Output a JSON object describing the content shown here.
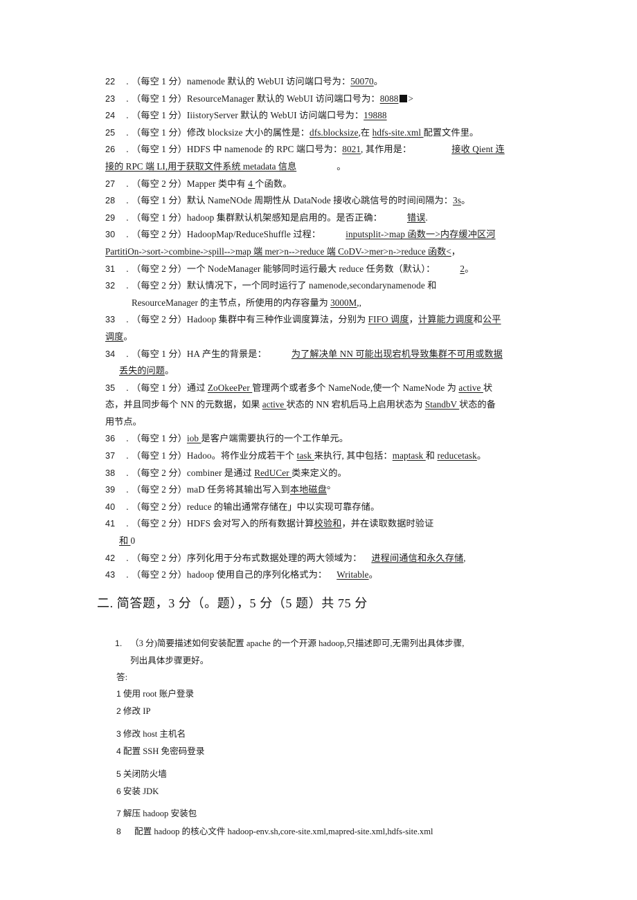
{
  "document": {
    "fill_in_blanks": [
      {
        "number": "22",
        "separator": ".",
        "parts": [
          {
            "t": "（每空 1 分）namenode 默认的 WebUI 访问端口号为：",
            "u": false
          },
          {
            "t": "50070",
            "u": true
          },
          {
            "t": "。",
            "u": false
          }
        ]
      },
      {
        "number": "23",
        "separator": ".",
        "parts": [
          {
            "t": "（每空 1 分）ResourceManager 默认的 WebUI 访问端口号为：",
            "u": false
          },
          {
            "t": "8088",
            "u": true
          },
          {
            "t": "BLACKBOX",
            "u": false
          },
          {
            "t": ">",
            "u": false
          }
        ]
      },
      {
        "number": "24",
        "separator": ".",
        "parts": [
          {
            "t": "（每空 1 分）IiistoryServer 默认的 WebUI 访问端口号为：",
            "u": false
          },
          {
            "t": "19888",
            "u": true
          }
        ]
      },
      {
        "number": "25",
        "separator": ".",
        "parts": [
          {
            "t": "（每空 1 分）修改 blocksize 大小的属性是：",
            "u": false
          },
          {
            "t": "dfs.blocksize",
            "u": true
          },
          {
            "t": ",在 ",
            "u": false
          },
          {
            "t": "hdfs-site.xml ",
            "u": true
          },
          {
            "t": "配置文件里。",
            "u": false
          }
        ]
      },
      {
        "number": "26",
        "separator": ".",
        "parts": [
          {
            "t": "（每空 1 分）HDFS 中 namenode 的 RPC 端口号为：",
            "u": false
          },
          {
            "t": "8021",
            "u": true
          },
          {
            "t": ", 其作用是：",
            "u": false
          },
          {
            "t": "GAP_LG",
            "u": false
          },
          {
            "t": "接收 Qient 连",
            "u": true
          }
        ],
        "continuation": [
          {
            "indent": "none",
            "parts": [
              {
                "t": "接的 RPC 端 LI,用于获取文件系统 metadata 信息",
                "u": true
              },
              {
                "t": "GAP_LG",
                "u": false
              },
              {
                "t": "。",
                "u": false
              }
            ]
          }
        ]
      },
      {
        "number": "27",
        "separator": ".",
        "parts": [
          {
            "t": "（每空 2 分）Mapper 类中有 ",
            "u": false
          },
          {
            "t": "4 ",
            "u": true
          },
          {
            "t": "个函数。",
            "u": false
          }
        ]
      },
      {
        "number": "28",
        "separator": ".",
        "parts": [
          {
            "t": "（每空 1 分）默认 NameNOde 周期性从 DataNode 接收心跳信号的时间间隔为：",
            "u": false
          },
          {
            "t": "3s",
            "u": true
          },
          {
            "t": "。",
            "u": false
          }
        ]
      },
      {
        "number": "29",
        "separator": ".",
        "parts": [
          {
            "t": "（每空 1 分）hadoop 集群默认机架感知是启用的。是否正确：",
            "u": false
          },
          {
            "t": "GAP",
            "u": false
          },
          {
            "t": "错误",
            "u": true
          },
          {
            "t": ".",
            "u": false
          }
        ]
      },
      {
        "number": "30",
        "separator": ".",
        "parts": [
          {
            "t": "（每空 2 分）HadoopMap/ReduceShuffle 过程：",
            "u": false
          },
          {
            "t": "GAP",
            "u": false
          },
          {
            "t": "inputsplit->map 函数一>内存缓冲区河",
            "u": true
          }
        ],
        "continuation": [
          {
            "indent": "none",
            "parts": [
              {
                "t": "PartitiOn->sort->combine->spill-->map 端 mer>n-->reduce 端 CoDV->mer>n->reduce 函数<",
                "u": true
              },
              {
                "t": "，",
                "u": false
              }
            ]
          }
        ]
      },
      {
        "number": "31",
        "separator": ".",
        "parts": [
          {
            "t": "（每空 2 分）一个 NodeManager 能够同时运行最大 reduce 任务数（默认）：",
            "u": false
          },
          {
            "t": "GAP",
            "u": false
          },
          {
            "t": "2",
            "u": true
          },
          {
            "t": "。",
            "u": false
          }
        ]
      },
      {
        "number": "32",
        "separator": ".",
        "parts": [
          {
            "t": "（每空 2 分）默认情况下，一个同时运行了 namenode,secondarynamenode 和",
            "u": false
          }
        ],
        "continuation": [
          {
            "indent": "ind",
            "parts": [
              {
                "t": "ResourceManager 的主节点，所使用的内存容量为 ",
                "u": false
              },
              {
                "t": "3000M",
                "u": true
              },
              {
                "t": ",,",
                "u": false
              }
            ]
          }
        ]
      },
      {
        "number": "33",
        "separator": ".",
        "parts": [
          {
            "t": "（每空 2 分）Hadoop 集群中有三种作业调度算法，分别为 ",
            "u": false
          },
          {
            "t": "FIFO 调度",
            "u": true
          },
          {
            "t": "，",
            "u": false
          },
          {
            "t": "计算能力调度",
            "u": true
          },
          {
            "t": "和",
            "u": false
          },
          {
            "t": "公平",
            "u": true
          }
        ],
        "continuation": [
          {
            "indent": "none",
            "parts": [
              {
                "t": "调度",
                "u": true
              },
              {
                "t": "。",
                "u": false
              }
            ]
          }
        ]
      },
      {
        "number": "34",
        "separator": ".",
        "parts": [
          {
            "t": "（每空 1 分）HA 产生的背景是：",
            "u": false
          },
          {
            "t": "GAP",
            "u": false
          },
          {
            "t": "为了解决单 NN 可能出现宕机导致集群不可用或数据",
            "u": true
          }
        ],
        "continuation": [
          {
            "indent": "ind2",
            "parts": [
              {
                "t": "丢失的问题",
                "u": true
              },
              {
                "t": "。",
                "u": false
              }
            ]
          }
        ]
      },
      {
        "number": "35",
        "separator": ".",
        "parts": [
          {
            "t": "（每空 1 分）通过 ",
            "u": false
          },
          {
            "t": "ZoOkeePer ",
            "u": true
          },
          {
            "t": "管理两个或者多个 NameNode,使一个 NameNode 为 ",
            "u": false
          },
          {
            "t": "active ",
            "u": true
          },
          {
            "t": "状",
            "u": false
          }
        ],
        "continuation": [
          {
            "indent": "full",
            "parts": [
              {
                "t": "态，并且同步每个 NN 的元数据，如果 ",
                "u": false
              },
              {
                "t": "active ",
                "u": true
              },
              {
                "t": "状态的 NN 宕机后马上启用状态为 ",
                "u": false
              },
              {
                "t": "StandbV ",
                "u": true
              },
              {
                "t": "状态的备",
                "u": false
              }
            ]
          },
          {
            "indent": "full",
            "parts": [
              {
                "t": "用节点。",
                "u": false
              }
            ]
          }
        ]
      },
      {
        "number": "36",
        "separator": ".",
        "parts": [
          {
            "t": "（每空 1 分）",
            "u": false
          },
          {
            "t": "iob ",
            "u": true
          },
          {
            "t": "是客户端需要执行的一个工作单元。",
            "u": false
          }
        ]
      },
      {
        "number": "37",
        "separator": ".",
        "parts": [
          {
            "t": "（每空 1 分）Hadoo。将作业分成若干个 ",
            "u": false
          },
          {
            "t": "task ",
            "u": true
          },
          {
            "t": "来执行, 其中包括：",
            "u": false
          },
          {
            "t": "maptask ",
            "u": true
          },
          {
            "t": "和 ",
            "u": false
          },
          {
            "t": "reducetask",
            "u": true
          },
          {
            "t": "。",
            "u": false
          }
        ]
      },
      {
        "number": "38",
        "separator": ".",
        "parts": [
          {
            "t": "（每空 2 分）combiner 是通过 ",
            "u": false
          },
          {
            "t": "RedUCer ",
            "u": true
          },
          {
            "t": "类来定义的。",
            "u": false
          }
        ]
      },
      {
        "number": "39",
        "separator": ".",
        "parts": [
          {
            "t": "（每空 2 分）maD 任务将其输出写入到",
            "u": false
          },
          {
            "t": "本地磁盘",
            "u": true
          },
          {
            "t": "°",
            "u": false
          }
        ]
      },
      {
        "number": "40",
        "separator": ".",
        "parts": [
          {
            "t": "（每空 2 分）reduce 的输出通常存储在」中以实现可靠存储。",
            "u": false
          }
        ]
      },
      {
        "number": "41",
        "separator": ".",
        "parts": [
          {
            "t": "（每空 2 分）HDFS 会对写入的所有数据计算",
            "u": false
          },
          {
            "t": "校验和",
            "u": true
          },
          {
            "t": "，并在读取数据时验证",
            "u": false
          }
        ],
        "continuation": [
          {
            "indent": "ind2",
            "parts": [
              {
                "t": "和 ",
                "u": true
              },
              {
                "t": "0",
                "u": false
              }
            ]
          }
        ]
      },
      {
        "number": "42",
        "separator": ".",
        "parts": [
          {
            "t": "（每空 2 分）序列化用于分布式数据处理的两大领域为：",
            "u": false
          },
          {
            "t": "GAP_SM",
            "u": false
          },
          {
            "t": "进程间通信和",
            "u": true
          },
          {
            "t": "永久存储",
            "u": true
          },
          {
            "t": ",",
            "u": false
          }
        ]
      },
      {
        "number": "43",
        "separator": ".",
        "parts": [
          {
            "t": "（每空 2 分）hadoop 使用自己的序列化格式为：",
            "u": false
          },
          {
            "t": "GAP_SM",
            "u": false
          },
          {
            "t": "Writable",
            "u": true
          },
          {
            "t": "。",
            "u": false
          }
        ]
      }
    ],
    "section_two": {
      "heading": "二. 简答题，3 分（。题），5 分（5 题）共 75 分",
      "question": {
        "number": "1.",
        "line1": "（3 分)简要描述如何安装配置 apache 的一个开源 hadoop,只描述即可,无需列出具体步骤,",
        "line2": "列出具体步骤更好。"
      },
      "answer": {
        "label": "答:",
        "steps": [
          {
            "idx": "1",
            "text": "使用 root 账户登录",
            "spaced": false,
            "wide": false
          },
          {
            "idx": "2",
            "text": "修改 IP",
            "spaced": false,
            "wide": false
          },
          {
            "idx": "3",
            "text": "修改 host 主机名",
            "spaced": true,
            "wide": false
          },
          {
            "idx": "4",
            "text": "配置 SSH 免密码登录",
            "spaced": false,
            "wide": false
          },
          {
            "idx": "5",
            "text": "关闭防火墙",
            "spaced": true,
            "wide": false
          },
          {
            "idx": "6",
            "text": "安装 JDK",
            "spaced": false,
            "wide": false
          },
          {
            "idx": "7",
            "text": "解压 hadoop 安装包",
            "spaced": true,
            "wide": false
          },
          {
            "idx": "8",
            "text": "配置 hadoop 的核心文件 hadoop-env.sh,core-site.xml,mapred-site.xml,hdfs-site.xml",
            "spaced": false,
            "wide": true
          }
        ]
      }
    }
  }
}
